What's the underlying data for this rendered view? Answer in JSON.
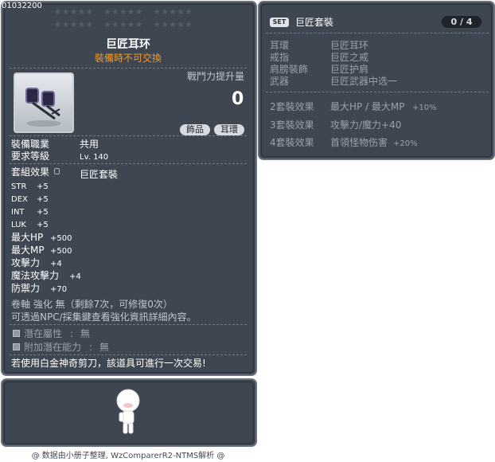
{
  "item": {
    "id": "01032200",
    "name": "巨匠耳环",
    "trade_note": "裝備時不可交換",
    "power_label": "戰鬥力提升量",
    "power_value": "0",
    "tags": [
      "飾品",
      "耳環"
    ],
    "job_label": "裝備職業",
    "job_value": "共用",
    "level_label": "要求等級",
    "level_value": "Lv. 140",
    "set_label": "套組效果",
    "set_value": "巨匠套裝",
    "stats": [
      {
        "name": "STR",
        "value": "+5"
      },
      {
        "name": "DEX",
        "value": "+5"
      },
      {
        "name": "INT",
        "value": "+5"
      },
      {
        "name": "LUK",
        "value": "+5"
      },
      {
        "name": "最大HP",
        "value": "+500"
      },
      {
        "name": "最大MP",
        "value": "+500"
      },
      {
        "name": "攻擊力",
        "value": "+4"
      },
      {
        "name": "魔法攻擊力",
        "value": "+4"
      },
      {
        "name": "防禦力",
        "value": "+70"
      }
    ],
    "scroll_line1": "卷軸 強化 無（剩餘7次，可修復0次）",
    "scroll_line2": "可透過NPC/採集鍵查看強化資訊詳細內容。",
    "potential_label": "潛在屬性",
    "potential_value": "無",
    "add_potential_label": "附加潛在能力",
    "add_potential_value": "無",
    "scissors_note": "若使用白金神奇剪刀，該道具可進行一次交易!"
  },
  "set": {
    "badge": "SET",
    "title": "巨匠套裝",
    "count": "0 / 4",
    "parts": [
      {
        "slot": "耳環",
        "item": "巨匠耳环"
      },
      {
        "slot": "戒指",
        "item": "巨匠之戒"
      },
      {
        "slot": "肩膀裝飾",
        "item": "巨匠护肩"
      },
      {
        "slot": "武器",
        "item": "巨匠武器中选一"
      }
    ],
    "effects": [
      {
        "label": "2套裝效果",
        "desc": "最大HP / 最大MP",
        "value": "+10%"
      },
      {
        "label": "3套裝效果",
        "desc": "攻擊力/魔力+40",
        "value": ""
      },
      {
        "label": "4套裝效果",
        "desc": "首領怪物伤害",
        "value": "+20%"
      }
    ]
  },
  "footer": "@ 数据由小册子整理, WzComparerR2-NTMS解析 @",
  "icons": [
    "earring-icon",
    "avatar-figure",
    "lock-icon",
    "checkbox-icon"
  ]
}
